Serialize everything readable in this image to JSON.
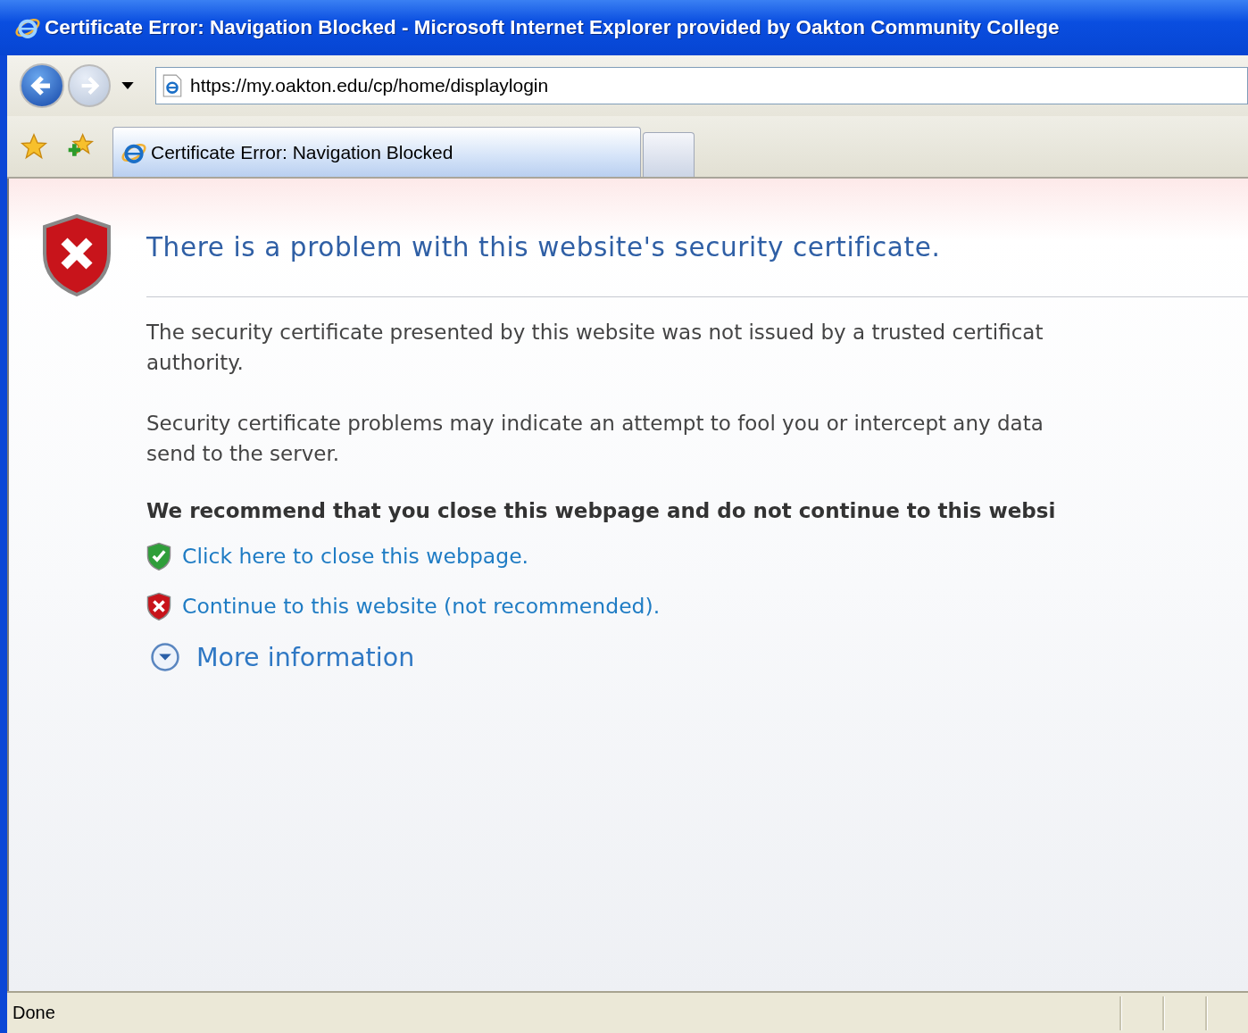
{
  "window": {
    "title": "Certificate Error: Navigation Blocked - Microsoft Internet Explorer provided by Oakton Community College"
  },
  "address_bar": {
    "value": "https://my.oakton.edu/cp/home/displaylogin"
  },
  "tabs": [
    {
      "label": "Certificate Error: Navigation Blocked",
      "selected": true
    }
  ],
  "page": {
    "heading": "There is a problem with this website's security certificate.",
    "paragraphs": [
      "The security certificate presented by this website was not issued by a trusted certificat",
      "authority.",
      "Security certificate problems may indicate an attempt to fool you or intercept any data",
      "send to the server."
    ],
    "recommendation": "We recommend that you close this webpage and do not continue to this websi",
    "links": [
      {
        "kind": "safe",
        "label": "Click here to close this webpage."
      },
      {
        "kind": "unsafe",
        "label": "Continue to this website (not recommended)."
      }
    ],
    "more_information": {
      "label": "More information",
      "expanded": false
    }
  },
  "status_bar": {
    "text": "Done"
  }
}
